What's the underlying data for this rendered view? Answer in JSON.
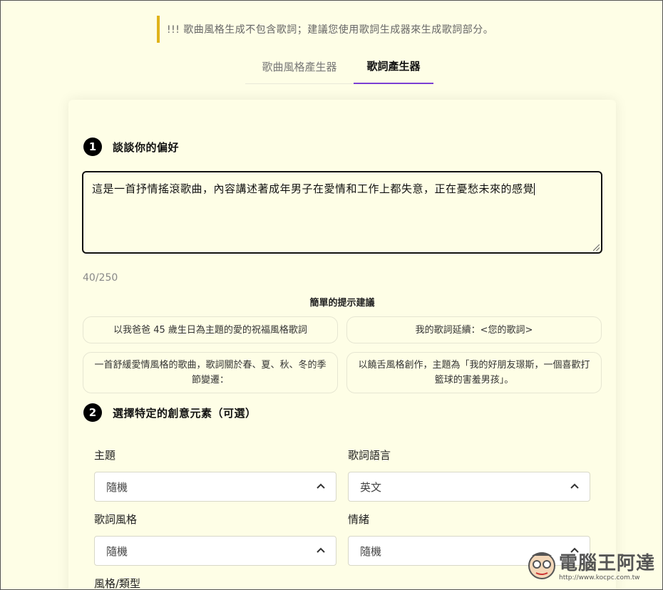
{
  "notice": "!!! 歌曲風格生成不包含歌詞；建議您使用歌詞生成器來生成歌詞部分。",
  "tabs": [
    {
      "label": "歌曲風格產生器",
      "active": false
    },
    {
      "label": "歌詞產生器",
      "active": true
    }
  ],
  "step1": {
    "number": "1",
    "title": "談談你的偏好"
  },
  "prompt": {
    "value": "這是一首抒情搖滾歌曲，內容講述著成年男子在愛情和工作上都失意，正在憂愁未來的感覺",
    "counter": "40/250"
  },
  "hints": {
    "title": "簡單的提示建議",
    "items": [
      "以我爸爸 45 歲生日為主題的愛的祝福風格歌詞",
      "我的歌詞延續：<您的歌詞>",
      "一首舒緩愛情風格的歌曲，歌詞關於春、夏、秋、冬的季節變遷：",
      "以饒舌風格創作，主題為「我的好朋友璟斯，一個喜歡打籃球的害羞男孩」。"
    ]
  },
  "step2": {
    "number": "2",
    "title": "選擇特定的創意元素（可選）"
  },
  "fields": [
    {
      "label": "主題",
      "value": "隨機"
    },
    {
      "label": "歌詞語言",
      "value": "英文"
    },
    {
      "label": "歌詞風格",
      "value": "隨機"
    },
    {
      "label": "情緒",
      "value": "隨機"
    },
    {
      "label": "風格/類型"
    }
  ],
  "watermark": {
    "text": "電腦王阿達",
    "url": "http://www.kocpc.com.tw"
  },
  "colors": {
    "accent": "#7b3fd4",
    "notice_bar": "#e0b31a",
    "background": "#fefee6"
  },
  "icons": {
    "select": "chevron-up-icon"
  }
}
